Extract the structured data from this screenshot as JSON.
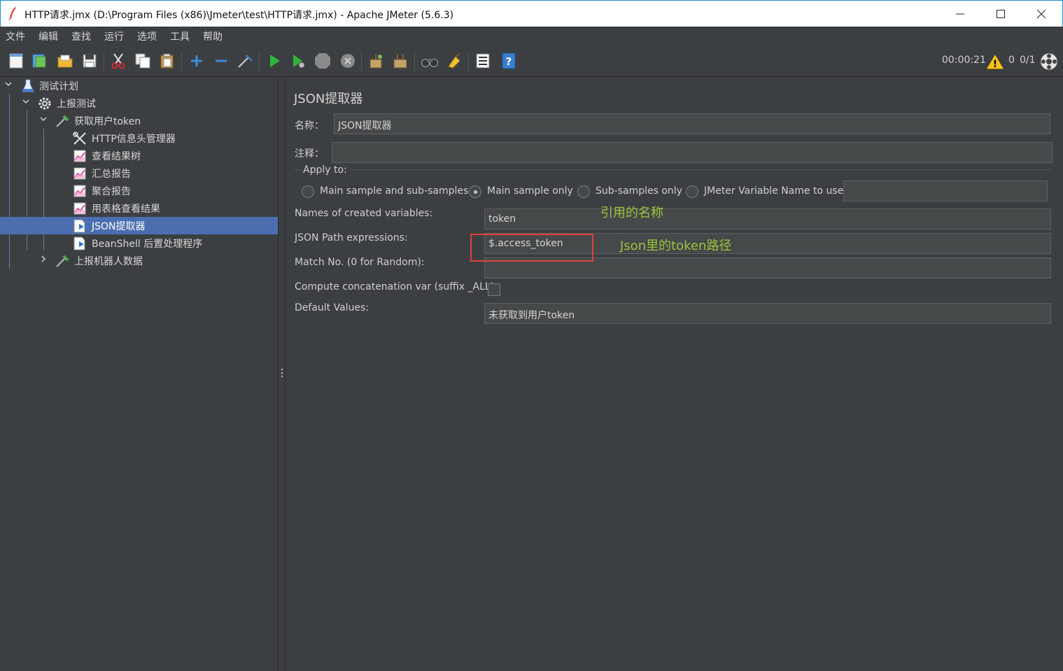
{
  "window": {
    "title": "HTTP请求.jmx (D:\\Program Files (x86)\\Jmeter\\test\\HTTP请求.jmx) - Apache JMeter (5.6.3)"
  },
  "menu": [
    "文件",
    "编辑",
    "查找",
    "运行",
    "选项",
    "工具",
    "帮助"
  ],
  "toolbar": {
    "timer": "00:00:21",
    "warnings": "0",
    "threads": "0/1"
  },
  "tree": {
    "items": [
      {
        "label": "测试计划"
      },
      {
        "label": "上报测试"
      },
      {
        "label": "获取用户token"
      },
      {
        "label": "HTTP信息头管理器"
      },
      {
        "label": "查看结果树"
      },
      {
        "label": "汇总报告"
      },
      {
        "label": "聚合报告"
      },
      {
        "label": "用表格查看结果"
      },
      {
        "label": "JSON提取器"
      },
      {
        "label": "BeanShell 后置处理程序"
      },
      {
        "label": "上报机器人数据"
      }
    ]
  },
  "panel": {
    "title": "JSON提取器",
    "name_label": "名称：",
    "name_value": "JSON提取器",
    "comment_label": "注释：",
    "comment_value": "",
    "apply_to_label": "Apply to:",
    "apply_options": [
      "Main sample and sub-samples",
      "Main sample only",
      "Sub-samples only",
      "JMeter Variable Name to use"
    ],
    "apply_selected": "Main sample only",
    "var_name_value": "",
    "names_label": "Names of created variables:",
    "names_value": "token",
    "path_label": "JSON Path expressions:",
    "path_value": "$.access_token",
    "match_label": "Match No. (0 for Random):",
    "match_value": "",
    "concat_label": "Compute concatenation var (suffix _ALL):",
    "concat_checked": false,
    "default_label": "Default Values:",
    "default_value": "未获取到用户token"
  },
  "annotations": {
    "names_note": "引用的名称",
    "path_note": "Json里的token路径",
    "color": "#9bc43c",
    "box_color": "#e0413c"
  }
}
